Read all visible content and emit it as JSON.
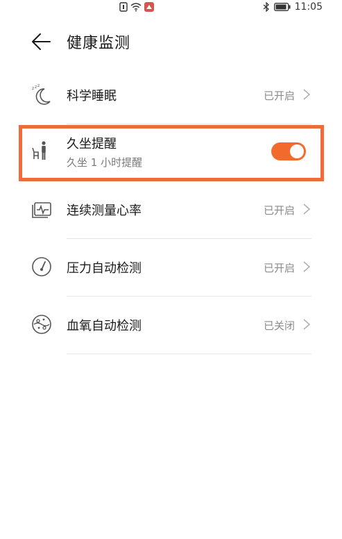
{
  "status_bar": {
    "time": "11:05"
  },
  "header": {
    "title": "健康监测"
  },
  "items": [
    {
      "title": "科学睡眠",
      "value": "已开启"
    },
    {
      "title": "久坐提醒",
      "subtitle": "久坐 1 小时提醒",
      "toggle_on": true
    },
    {
      "title": "连续测量心率",
      "value": "已开启"
    },
    {
      "title": "压力自动检测",
      "value": "已开启"
    },
    {
      "title": "血氧自动检测",
      "value": "已关闭"
    }
  ],
  "colors": {
    "accent": "#f26a2c",
    "highlight": "#f06a3a"
  }
}
